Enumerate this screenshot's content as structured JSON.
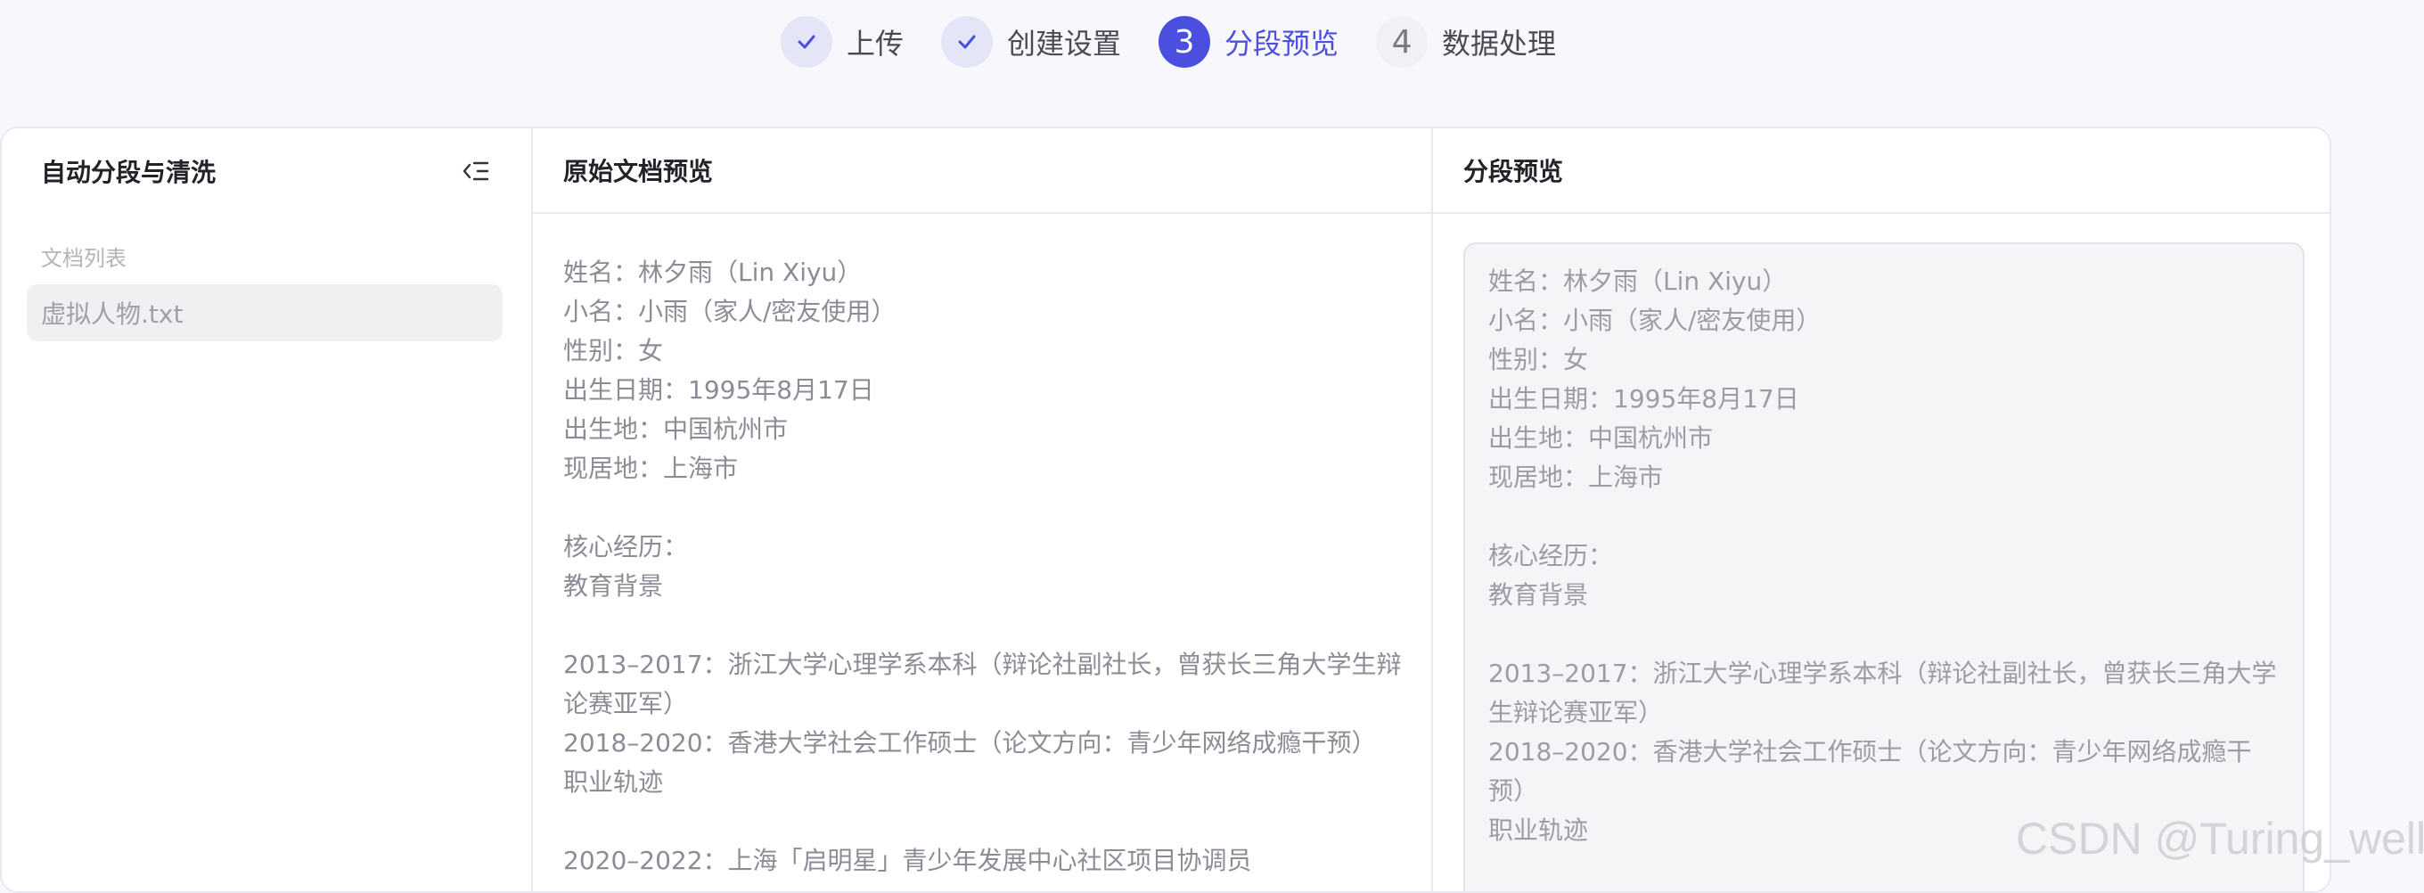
{
  "stepper": {
    "steps": [
      {
        "label": "上传",
        "state": "done",
        "number": ""
      },
      {
        "label": "创建设置",
        "state": "done",
        "number": ""
      },
      {
        "label": "分段预览",
        "state": "active",
        "number": "3"
      },
      {
        "label": "数据处理",
        "state": "todo",
        "number": "4"
      }
    ],
    "accent_color": "#4b4fe0"
  },
  "sidebar": {
    "title": "自动分段与清洗",
    "collapse_icon": "collapse-menu-icon",
    "doc_list_label": "文档列表",
    "documents": [
      {
        "name": "虚拟人物.txt"
      }
    ]
  },
  "original": {
    "title": "原始文档预览",
    "lines": [
      "姓名：林夕雨（Lin Xiyu）",
      "小名：小雨（家人/密友使用）",
      "性别：女",
      "出生日期：1995年8月17日",
      "出生地：中国杭州市",
      "现居地：上海市",
      "",
      "核心经历：",
      "教育背景",
      "",
      "2013–2017：浙江大学心理学系本科（辩论社副社长，曾获长三角大学生辩",
      "论赛亚军）",
      "2018–2020：香港大学社会工作硕士（论文方向：青少年网络成瘾干预）",
      "职业轨迹",
      "",
      "2020–2022：上海「启明星」青少年发展中心社区项目协调员"
    ]
  },
  "preview": {
    "title": "分段预览",
    "lines": [
      "姓名：林夕雨（Lin Xiyu）",
      "小名：小雨（家人/密友使用）",
      "性别：女",
      "出生日期：1995年8月17日",
      "出生地：中国杭州市",
      "现居地：上海市",
      "",
      "核心经历：",
      "教育背景",
      "",
      "2013–2017：浙江大学心理学系本科（辩论社副社长，曾获长三角大学",
      "生辩论赛亚军）",
      "2018–2020：香港大学社会工作硕士（论文方向：青少年网络成瘾干",
      "预）",
      "职业轨迹"
    ]
  },
  "watermark": "CSDN @Turing_well"
}
